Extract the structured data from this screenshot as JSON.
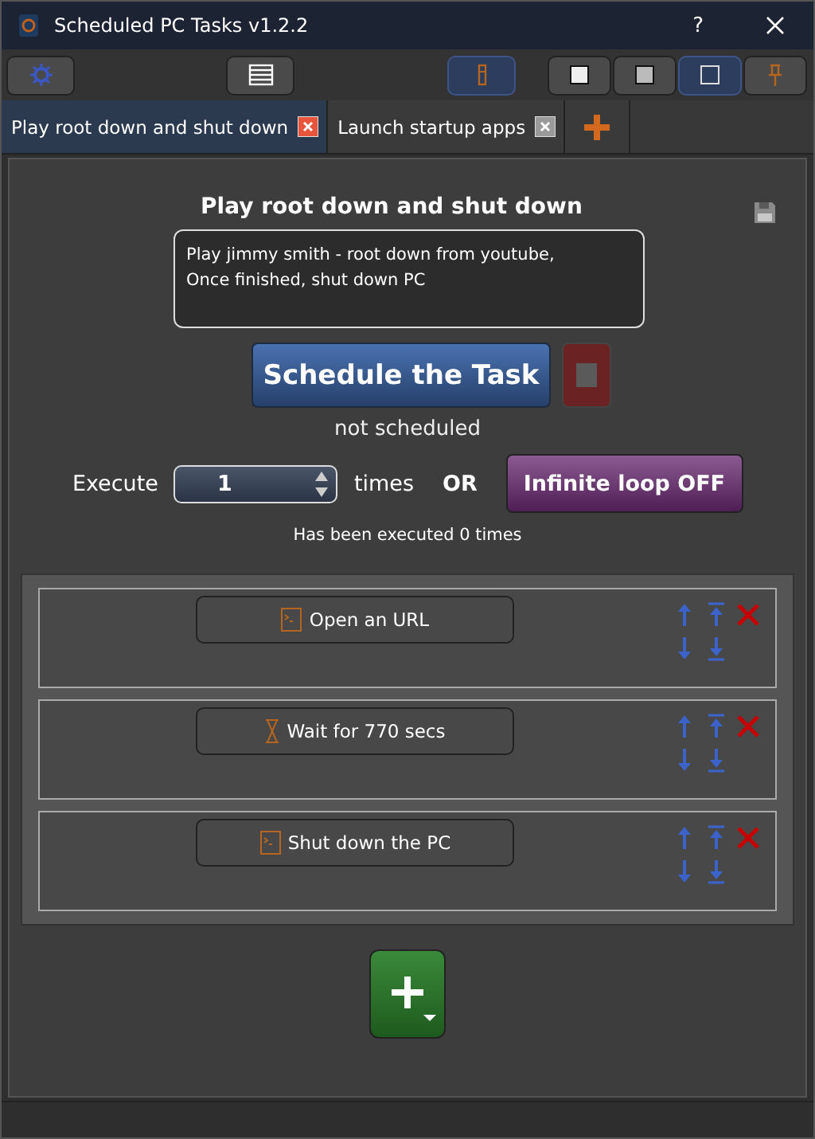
{
  "window": {
    "title": "Scheduled PC Tasks v1.2.2",
    "help": "?"
  },
  "window_modes": [
    {
      "selected": false
    },
    {
      "selected": false
    },
    {
      "selected": true
    }
  ],
  "tabs": [
    {
      "label": "Play root down and shut down",
      "selected": true
    },
    {
      "label": "Launch startup apps",
      "selected": false
    }
  ],
  "task": {
    "title": "Play root down and shut down",
    "description": "Play jimmy smith - root down from youtube,\nOnce finished, shut down PC",
    "schedule_button": "Schedule the Task",
    "status": "not scheduled",
    "execute_label": "Execute",
    "times_value": "1",
    "times_label": "times",
    "or_label": "OR",
    "loop_button": "Infinite loop OFF",
    "executed_text": "Has been executed 0 times"
  },
  "steps": [
    {
      "kind": "command",
      "label": "Open an URL"
    },
    {
      "kind": "wait",
      "label": "Wait for 770 secs"
    },
    {
      "kind": "command",
      "label": "Shut down the PC"
    }
  ]
}
